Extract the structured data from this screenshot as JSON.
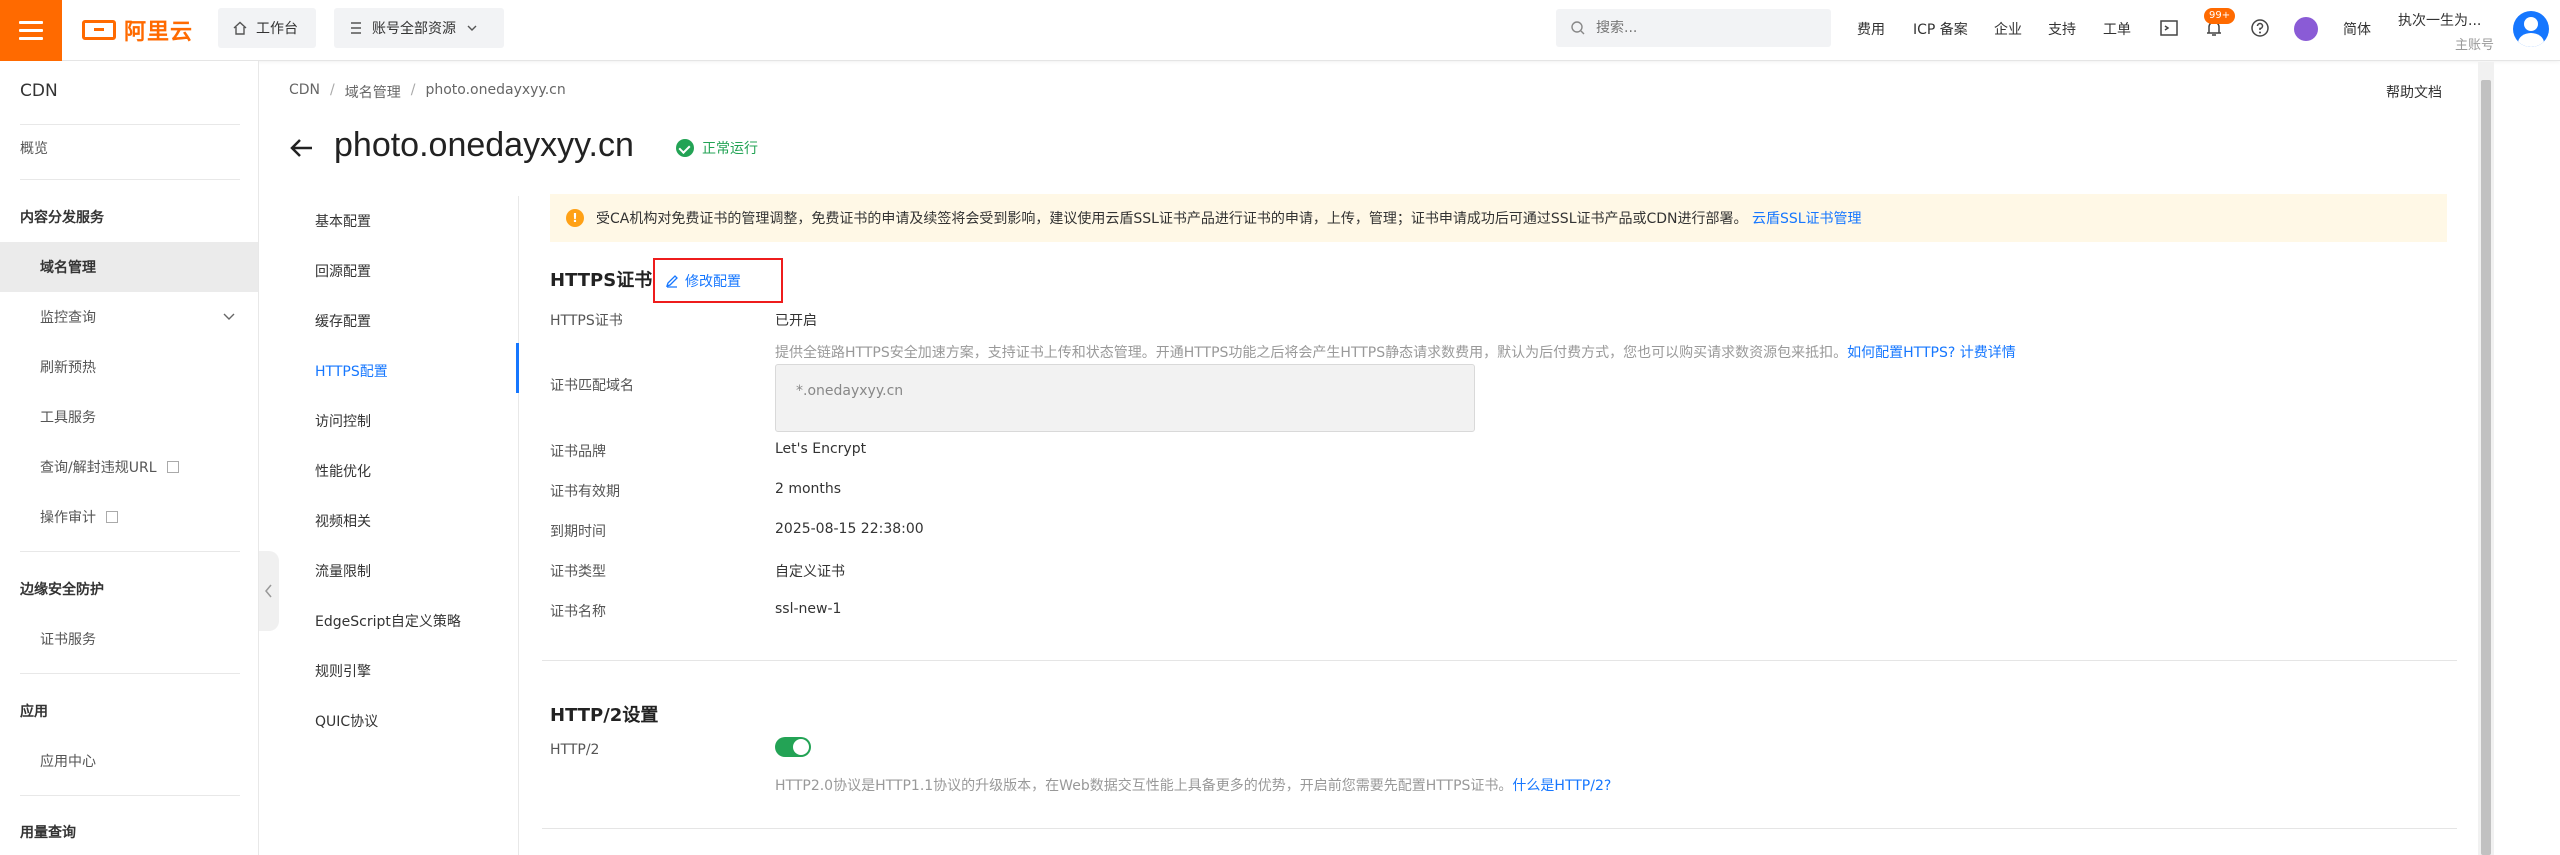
{
  "topbar": {
    "brand": "阿里云",
    "workbench": "工作台",
    "resources": "账号全部资源",
    "search_placeholder": "搜索...",
    "links": [
      "费用",
      "ICP 备案",
      "企业",
      "支持",
      "工单"
    ],
    "badge": "99+",
    "language": "简体",
    "user_name": "执次一生为...",
    "user_role": "主账号"
  },
  "sidebar": {
    "title": "CDN",
    "overview": "概览",
    "groups": [
      {
        "title": "内容分发服务",
        "items": [
          "域名管理",
          "监控查询",
          "刷新预热",
          "工具服务",
          "查询/解封违规URL",
          "操作审计"
        ]
      },
      {
        "title": "边缘安全防护",
        "items": [
          "证书服务"
        ]
      },
      {
        "title": "应用",
        "items": [
          "应用中心"
        ]
      },
      {
        "title": "用量查询",
        "items": []
      }
    ]
  },
  "breadcrumb": [
    "CDN",
    "域名管理",
    "photo.onedayxyy.cn"
  ],
  "help": "帮助文档",
  "page": {
    "title": "photo.onedayxyy.cn",
    "status": "正常运行"
  },
  "subnav": [
    "基本配置",
    "回源配置",
    "缓存配置",
    "HTTPS配置",
    "访问控制",
    "性能优化",
    "视频相关",
    "流量限制",
    "EdgeScript自定义策略",
    "规则引擎",
    "QUIC协议"
  ],
  "notice": {
    "text": "受CA机构对免费证书的管理调整，免费证书的申请及续签将会受到影响，建议使用云盾SSL证书产品进行证书的申请，上传，管理；证书申请成功后可通过SSL证书产品或CDN进行部署。",
    "link": "云盾SSL证书管理"
  },
  "https": {
    "title": "HTTPS证书",
    "edit": "修改配置",
    "fields": {
      "cert_label": "HTTPS证书",
      "cert_value": "已开启",
      "desc": "提供全链路HTTPS安全加速方案，支持证书上传和状态管理。开通HTTPS功能之后将会产生HTTPS静态请求数费用，默认为后付费方式，您也可以购买请求数资源包来抵扣。",
      "desc_link1": "如何配置HTTPS?",
      "desc_link2": "计费详情",
      "domain_label": "证书匹配域名",
      "domain_value": "*.onedayxyy.cn",
      "brand_label": "证书品牌",
      "brand_value": "Let's Encrypt",
      "validity_label": "证书有效期",
      "validity_value": "2 months",
      "expire_label": "到期时间",
      "expire_value": "2025-08-15 22:38:00",
      "type_label": "证书类型",
      "type_value": "自定义证书",
      "name_label": "证书名称",
      "name_value": "ssl-new-1"
    }
  },
  "http2": {
    "title": "HTTP/2设置",
    "label": "HTTP/2",
    "enabled": true,
    "desc": "HTTP2.0协议是HTTP1.1协议的升级版本，在Web数据交互性能上具备更多的优势，开启前您需要先配置HTTPS证书。",
    "desc_link": "什么是HTTP/2?"
  },
  "colors": {
    "accent": "#ff6a00",
    "link": "#1677ff",
    "success": "#23a355",
    "highlight": "#ee1c1c"
  }
}
